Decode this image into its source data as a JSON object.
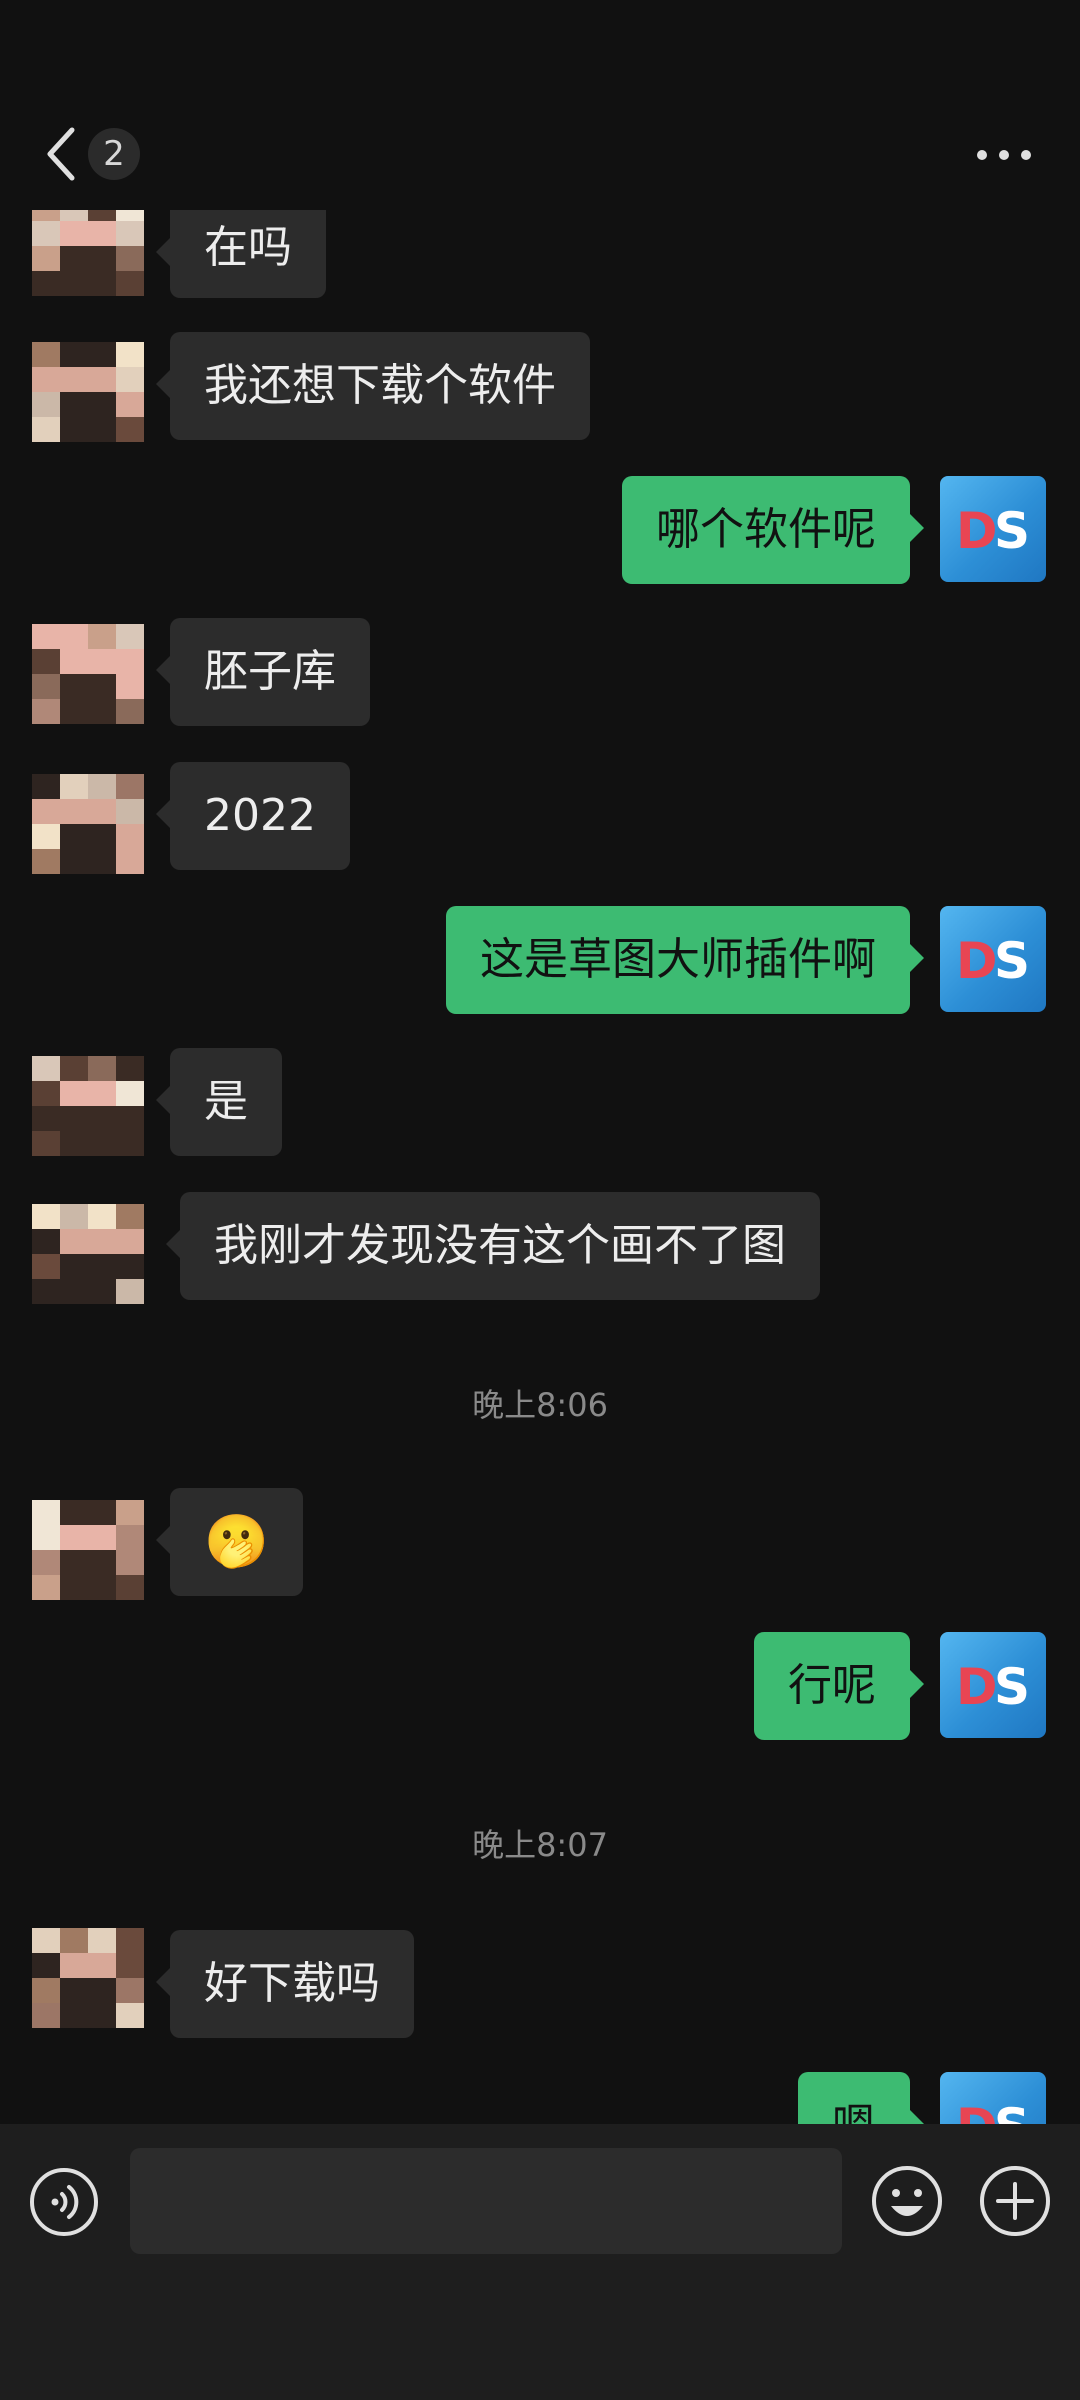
{
  "header": {
    "unread_count": "2",
    "back_icon": "chevron-left-icon",
    "more_icon": "more-dots-icon"
  },
  "messages": [
    {
      "side": "in",
      "text": "在吗"
    },
    {
      "side": "in",
      "text": "我还想下载个软件"
    },
    {
      "side": "out",
      "text": "哪个软件呢"
    },
    {
      "side": "in",
      "text": "胚子库"
    },
    {
      "side": "in",
      "text": "2022"
    },
    {
      "side": "out",
      "text": "这是草图大师插件啊"
    },
    {
      "side": "in",
      "text": "是"
    },
    {
      "side": "in",
      "text": "我刚才发现没有这个画不了图"
    },
    {
      "side": "in",
      "text": "🫢"
    },
    {
      "side": "out",
      "text": "行呢"
    },
    {
      "side": "in",
      "text": "好下载吗"
    },
    {
      "side": "out",
      "text": "嗯"
    }
  ],
  "timestamps": [
    "晚上8:06",
    "晚上8:07"
  ],
  "my_avatar_text": {
    "d": "D",
    "s": "S"
  },
  "input": {
    "placeholder": "",
    "value": ""
  },
  "colors": {
    "background": "#111111",
    "bubble_in": "#2c2c2c",
    "bubble_out": "#3dbb72",
    "avatar_d": "#e84553",
    "avatar_s": "#ffffff"
  }
}
